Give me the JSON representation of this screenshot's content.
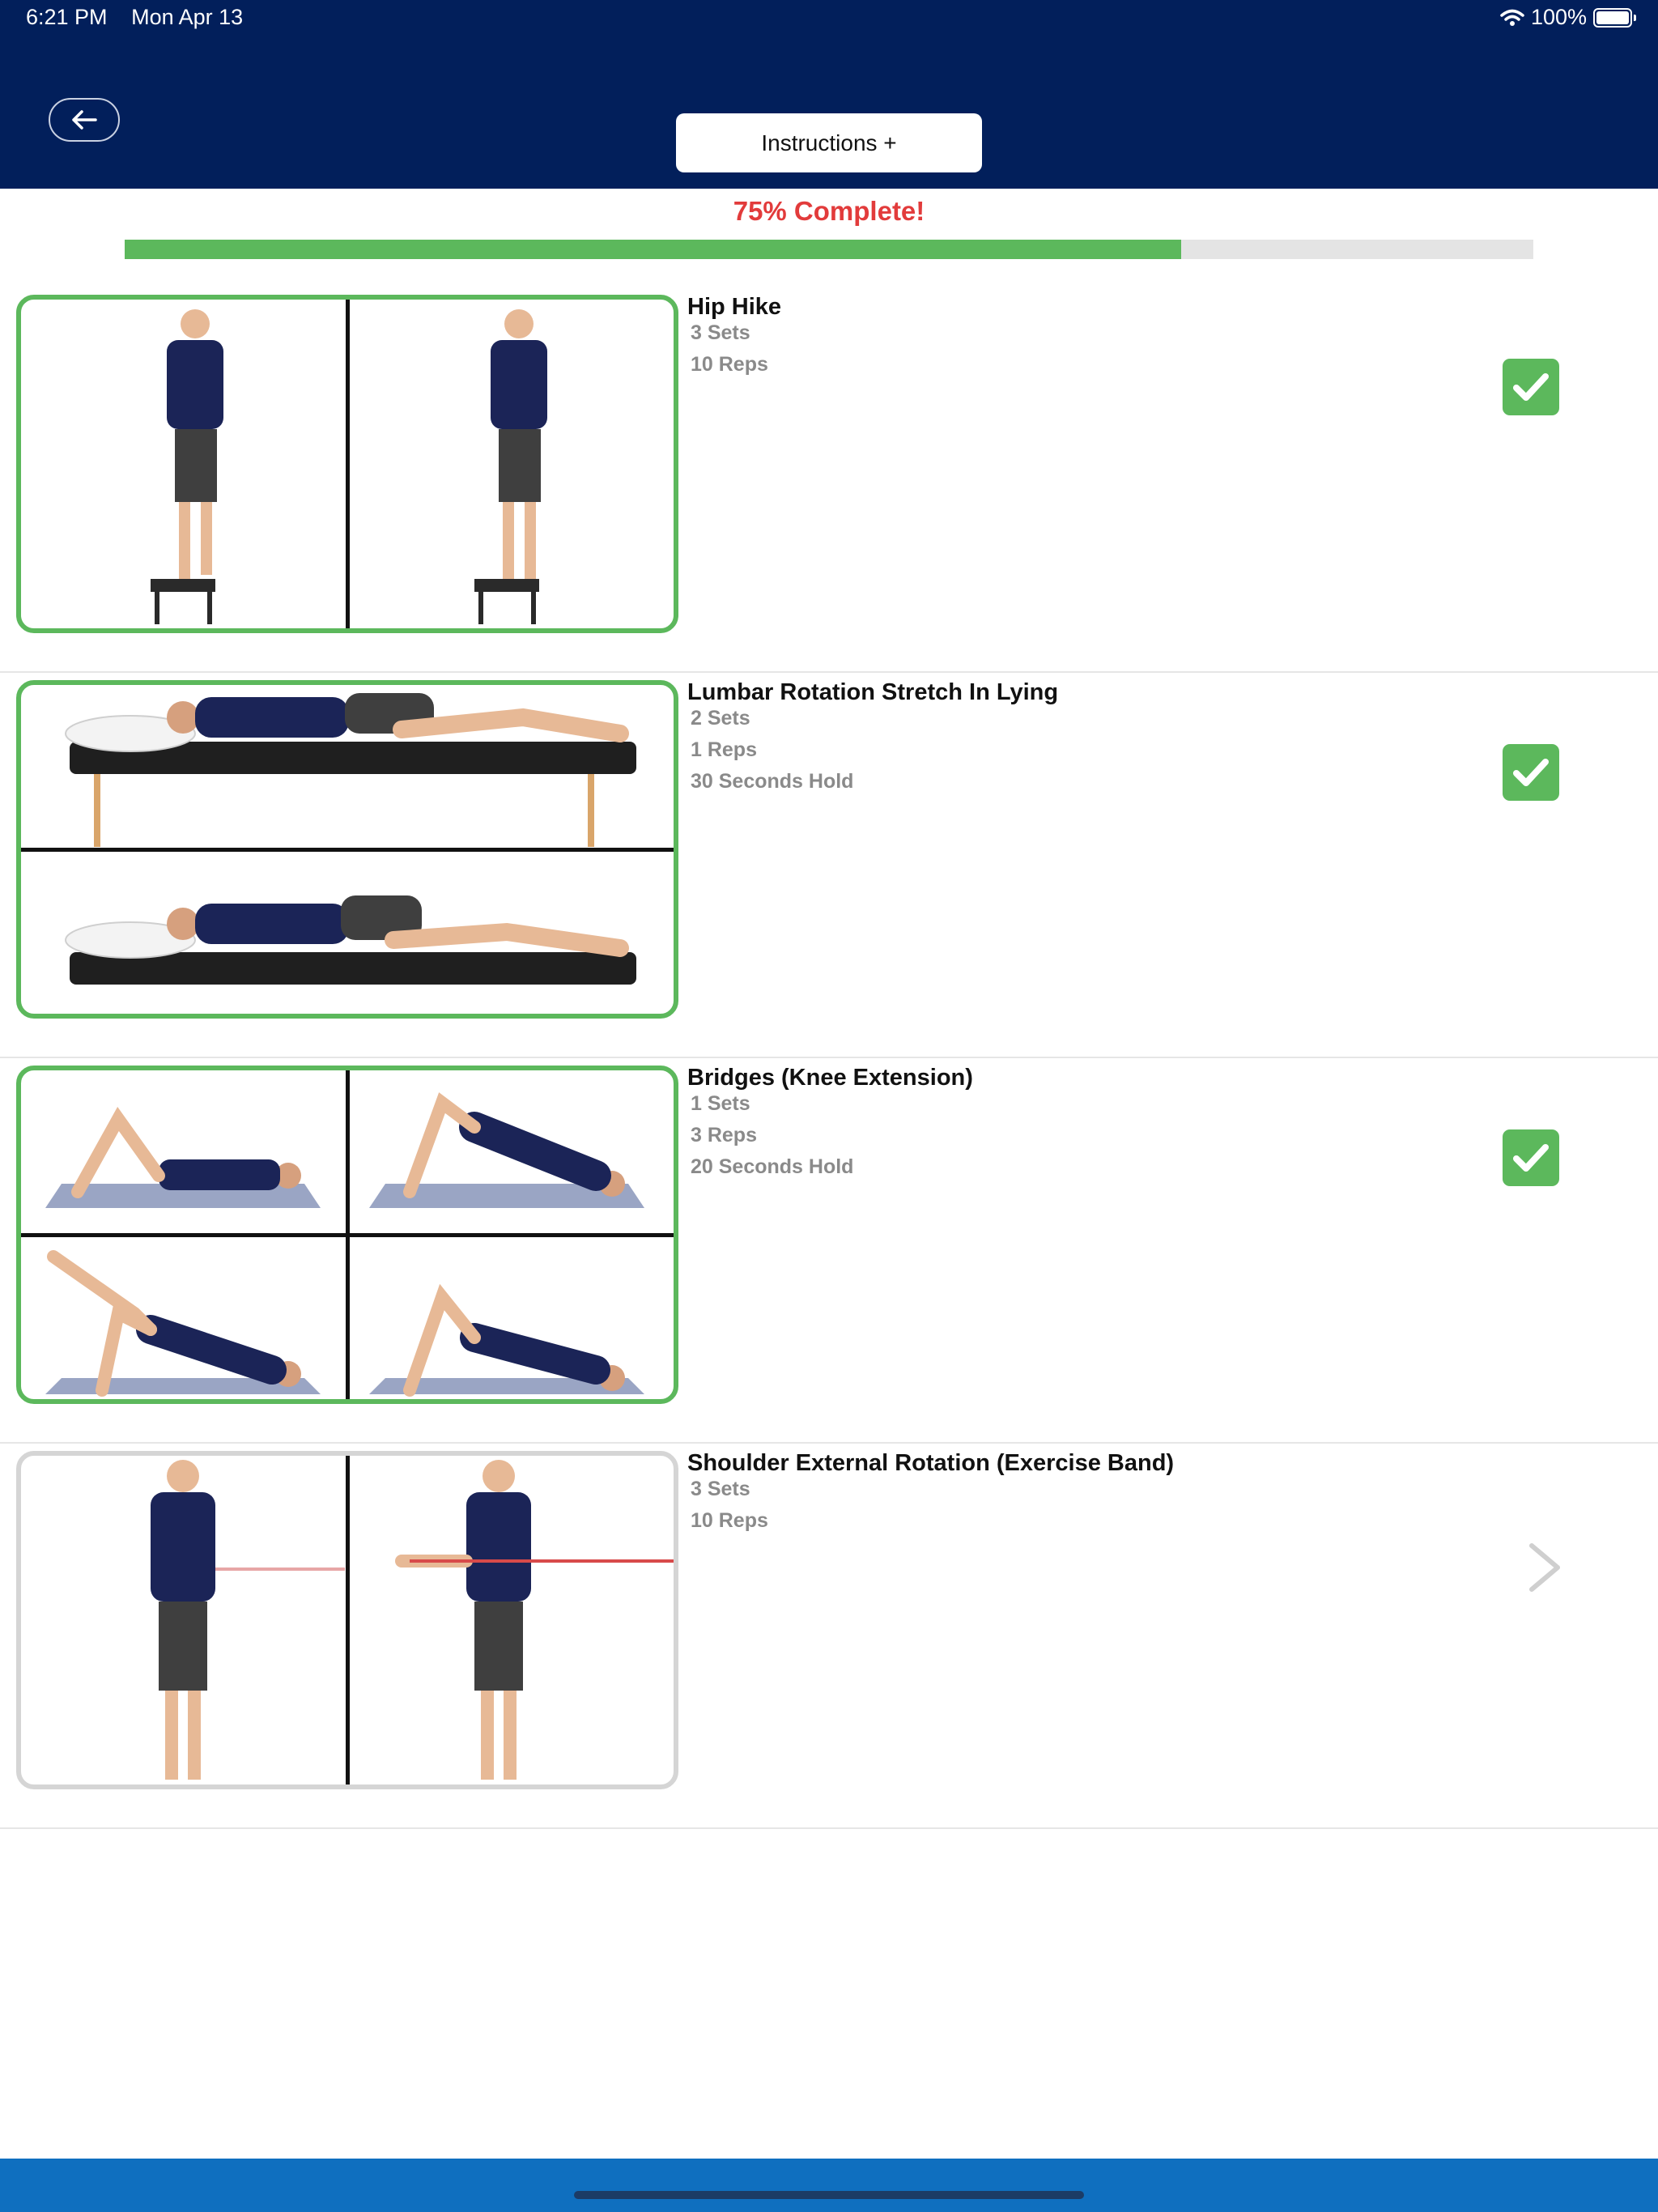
{
  "status_bar": {
    "time": "6:21 PM",
    "date": "Mon Apr 13",
    "battery": "100%"
  },
  "header": {
    "back_icon": "arrow-left-icon",
    "instructions_label": "Instructions +"
  },
  "progress": {
    "label": "75% Complete!",
    "fraction": 0.75,
    "color": "#5cb85c"
  },
  "exercises": [
    {
      "title": "Hip Hike",
      "details": [
        "3 Sets",
        "10 Reps"
      ],
      "completed": true,
      "status_icon": "checkbox-checked-icon"
    },
    {
      "title": "Lumbar Rotation Stretch In Lying",
      "details": [
        "2 Sets",
        "1 Reps",
        "30 Seconds Hold"
      ],
      "completed": true,
      "status_icon": "checkbox-checked-icon"
    },
    {
      "title": "Bridges (Knee Extension)",
      "details": [
        "1 Sets",
        "3 Reps",
        "20 Seconds Hold"
      ],
      "completed": true,
      "status_icon": "checkbox-checked-icon"
    },
    {
      "title": "Shoulder External Rotation (Exercise Band)",
      "details": [
        "3 Sets",
        "10 Reps"
      ],
      "completed": false,
      "status_icon": "chevron-right-icon"
    }
  ],
  "colors": {
    "header": "#021f5b",
    "complete": "#5cb85c",
    "progress_text": "#e23b3b",
    "footer": "#0f6fbf"
  }
}
